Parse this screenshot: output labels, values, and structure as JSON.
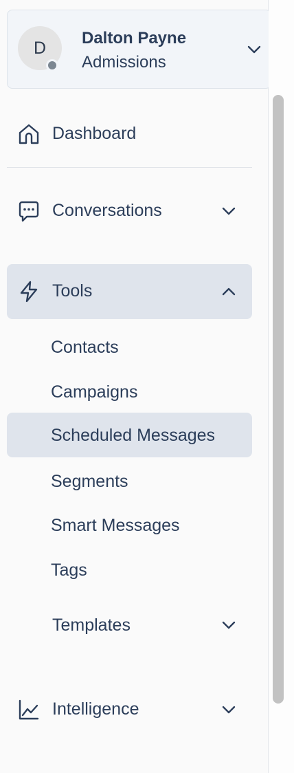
{
  "user": {
    "initial": "D",
    "name": "Dalton Payne",
    "role": "Admissions",
    "presence_color": "#7c8792",
    "menu_icon": "chevron-down-icon"
  },
  "nav": {
    "dashboard": {
      "label": "Dashboard",
      "icon": "home-icon"
    },
    "conversations": {
      "label": "Conversations",
      "icon": "chat-bubble-icon",
      "expanded": false
    },
    "tools": {
      "label": "Tools",
      "icon": "lightning-icon",
      "expanded": true,
      "items": [
        {
          "label": "Contacts"
        },
        {
          "label": "Campaigns"
        },
        {
          "label": "Scheduled Messages",
          "active": true
        },
        {
          "label": "Segments"
        },
        {
          "label": "Smart Messages"
        },
        {
          "label": "Tags"
        }
      ],
      "templates": {
        "label": "Templates",
        "expanded": false
      }
    },
    "intelligence": {
      "label": "Intelligence",
      "icon": "line-chart-icon",
      "expanded": false
    }
  },
  "colors": {
    "text": "#2c3e5a",
    "active_bg": "#dfe4ec",
    "card_bg": "#f2f5f9",
    "scrollbar": "#c2c2c2"
  }
}
